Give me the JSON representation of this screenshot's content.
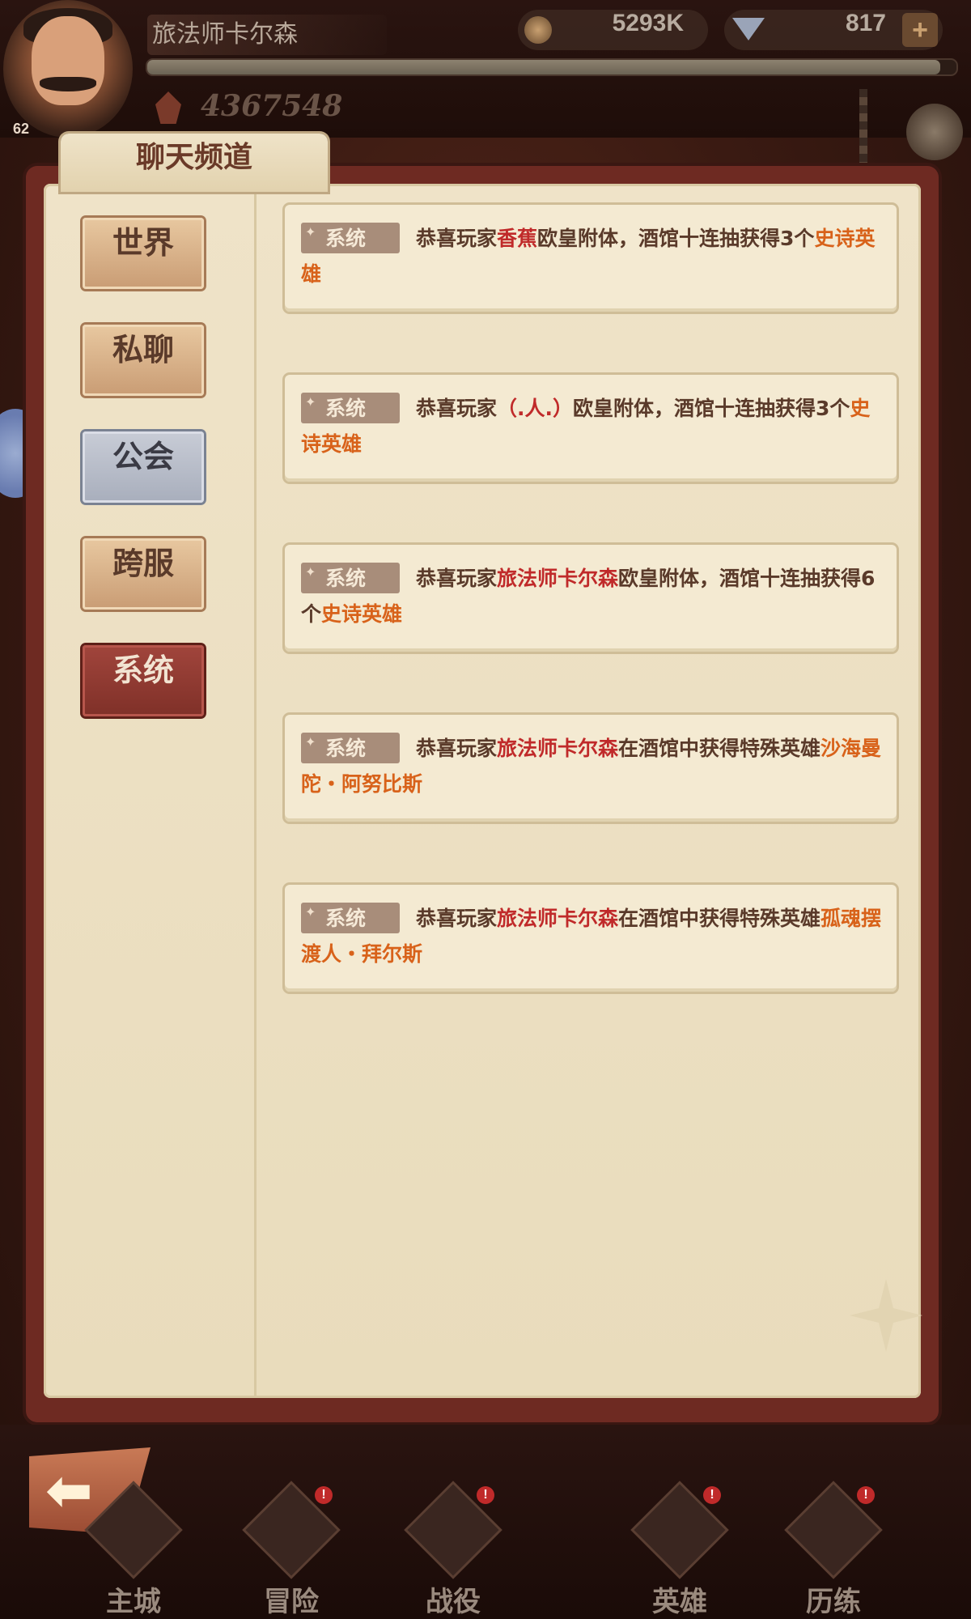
{
  "header": {
    "player_name": "旅法师卡尔森",
    "level": "62",
    "coins": "5293K",
    "gems": "817",
    "power": "4367548",
    "plus_label": "+",
    "exp_progress": 0.98
  },
  "panel": {
    "title": "聊天频道"
  },
  "sidebar": {
    "tabs": [
      {
        "label": "世界"
      },
      {
        "label": "私聊"
      },
      {
        "label": "公会"
      },
      {
        "label": "跨服"
      },
      {
        "label": "系统"
      }
    ],
    "active": "系统"
  },
  "messages": [
    {
      "badge": "系统",
      "pre": "恭喜玩家",
      "player": "香蕉",
      "mid": "欧皇附体，酒馆十连抽获得3个",
      "hero": "史诗英雄"
    },
    {
      "badge": "系统",
      "pre": "恭喜玩家",
      "player": "（.人.）",
      "mid": "欧皇附体，酒馆十连抽获得3个",
      "hero": "史诗英雄"
    },
    {
      "badge": "系统",
      "pre": "恭喜玩家",
      "player": "旅法师卡尔森",
      "mid": "欧皇附体，酒馆十连抽获得6个",
      "hero": "史诗英雄"
    },
    {
      "badge": "系统",
      "pre": "恭喜玩家",
      "player": "旅法师卡尔森",
      "mid": "在酒馆中获得特殊英雄",
      "hero": "沙海曼陀・阿努比斯"
    },
    {
      "badge": "系统",
      "pre": "恭喜玩家",
      "player": "旅法师卡尔森",
      "mid": "在酒馆中获得特殊英雄",
      "hero": "孤魂摆渡人・拜尔斯"
    }
  ],
  "bottom_nav": {
    "back_icon": "back-arrow-icon",
    "items": [
      {
        "label": "主城",
        "alert": "!"
      },
      {
        "label": "冒险",
        "alert": "!"
      },
      {
        "label": "战役",
        "alert": "!"
      },
      {
        "label": "英雄",
        "alert": "!"
      },
      {
        "label": "历练",
        "alert": "!"
      }
    ]
  },
  "colors": {
    "player_name": "#c02a2a",
    "hero_name": "#d8621a",
    "active_tab": "#8f3a30"
  }
}
